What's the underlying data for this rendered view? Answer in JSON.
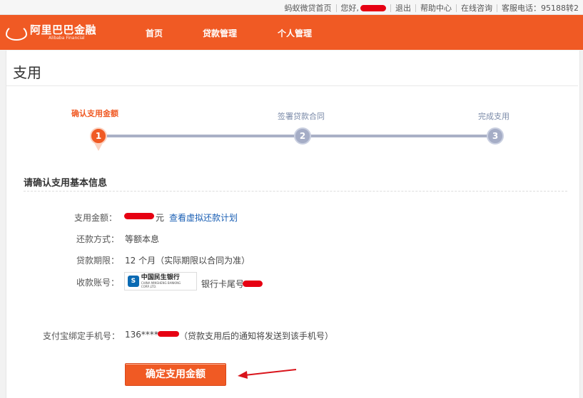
{
  "topbar": {
    "home": "蚂蚁微贷首页",
    "greeting": "您好,",
    "logout": "退出",
    "help": "帮助中心",
    "online": "在线咨询",
    "hotline": "客服电话：95188转2"
  },
  "brand": {
    "name_cn": "阿里巴巴金融",
    "name_en": "Alibaba Financial",
    "color": "#f05a24"
  },
  "nav": {
    "items": [
      "首页",
      "贷款管理",
      "个人管理"
    ]
  },
  "page": {
    "title": "支用"
  },
  "steps": [
    {
      "number": "1",
      "label": "确认支用金额",
      "active": true
    },
    {
      "number": "2",
      "label": "签署贷款合同",
      "active": false
    },
    {
      "number": "3",
      "label": "完成支用",
      "active": false
    }
  ],
  "section": {
    "title": "请确认支用基本信息"
  },
  "fields": {
    "amount_label": "支用金额：",
    "amount_unit": "元",
    "amount_link": "查看虚拟还款计划",
    "repay_label": "还款方式：",
    "repay_value": "等额本息",
    "term_label": "贷款期限：",
    "term_value": "12 个月（实际期限以合同为准）",
    "account_label": "收款账号：",
    "bank_name": "中国民生银行",
    "bank_name_en": "CHINA MINSHENG BANKING CORP.,LTD.",
    "bank_suffix": "银行卡尾号",
    "phone_label": "支付宝绑定手机号：",
    "phone_prefix": "136****",
    "phone_note": "（贷款支用后的通知将发送到该手机号）"
  },
  "actions": {
    "confirm": "确定支用金额"
  },
  "icons": {
    "bank": "minsheng-bank-icon",
    "annotation": "red-arrow-icon",
    "logo": "alibaba-logo-icon"
  }
}
